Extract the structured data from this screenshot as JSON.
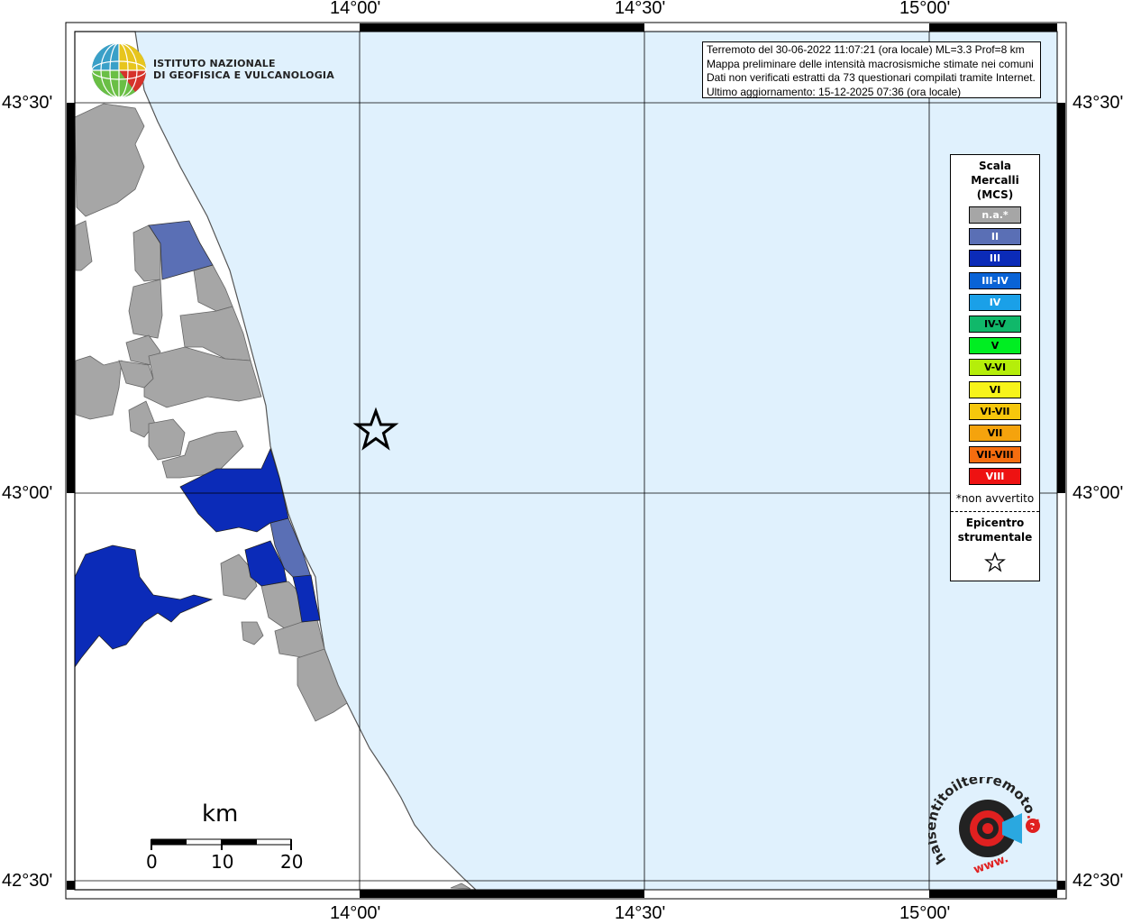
{
  "institution": {
    "line1": "ISTITUTO NAZIONALE",
    "line2": "DI GEOFISICA E VULCANOLOGIA"
  },
  "info": {
    "line1": "Terremoto del 30-06-2022 11:07:21 (ora locale) ML=3.3 Prof=8 km",
    "line2": "Mappa preliminare delle intensità macrosismiche stimate nei comuni",
    "line3": "Dati non verificati estratti da 73 questionari compilati tramite Internet.",
    "line4": "Ultimo aggiornamento: 15-12-2025 07:36 (ora locale)"
  },
  "axes": {
    "lon_top": [
      "14°00'",
      "14°30'",
      "15°00'"
    ],
    "lon_bottom": [
      "14°00'",
      "14°30'",
      "15°00'"
    ],
    "lat_left": [
      "43°30'",
      "43°00'",
      "42°30'"
    ],
    "lat_right": [
      "43°30'",
      "43°00'",
      "42°30'"
    ]
  },
  "legend": {
    "title_line1": "Scala",
    "title_line2": "Mercalli",
    "title_line3": "(MCS)",
    "items": [
      {
        "label": "n.a.*",
        "color": "#a6a6a6",
        "text_color": "#ffffff"
      },
      {
        "label": "II",
        "color": "#5a6fb5",
        "text_color": "#ffffff"
      },
      {
        "label": "III",
        "color": "#0b2bb8",
        "text_color": "#ffffff"
      },
      {
        "label": "III-IV",
        "color": "#0a63d6",
        "text_color": "#ffffff"
      },
      {
        "label": "IV",
        "color": "#1aa0e8",
        "text_color": "#ffffff"
      },
      {
        "label": "IV-V",
        "color": "#10b86a",
        "text_color": "#000000"
      },
      {
        "label": "V",
        "color": "#00ee22",
        "text_color": "#000000"
      },
      {
        "label": "V-VI",
        "color": "#b5ee0a",
        "text_color": "#000000"
      },
      {
        "label": "VI",
        "color": "#f7f31a",
        "text_color": "#000000"
      },
      {
        "label": "VI-VII",
        "color": "#f6c70c",
        "text_color": "#000000"
      },
      {
        "label": "VII",
        "color": "#f5a30d",
        "text_color": "#000000"
      },
      {
        "label": "VII-VIII",
        "color": "#f56d0f",
        "text_color": "#000000"
      },
      {
        "label": "VIII",
        "color": "#ee1212",
        "text_color": "#ffffff"
      }
    ],
    "note": "*non avvertito",
    "epicenter_line1": "Epicentro",
    "epicenter_line2": "strumentale"
  },
  "scale_bar": {
    "title": "km",
    "labels": [
      "0",
      "10",
      "20"
    ]
  },
  "colors": {
    "sea": "#e0f1fd",
    "land": "#ffffff",
    "na": "#a6a6a6",
    "ii": "#5a6fb5",
    "iii": "#0b2bb8"
  },
  "hai_logo": {
    "text_main": "haisentitoilterremoto",
    "text_it": ".it",
    "text_www": "www."
  }
}
